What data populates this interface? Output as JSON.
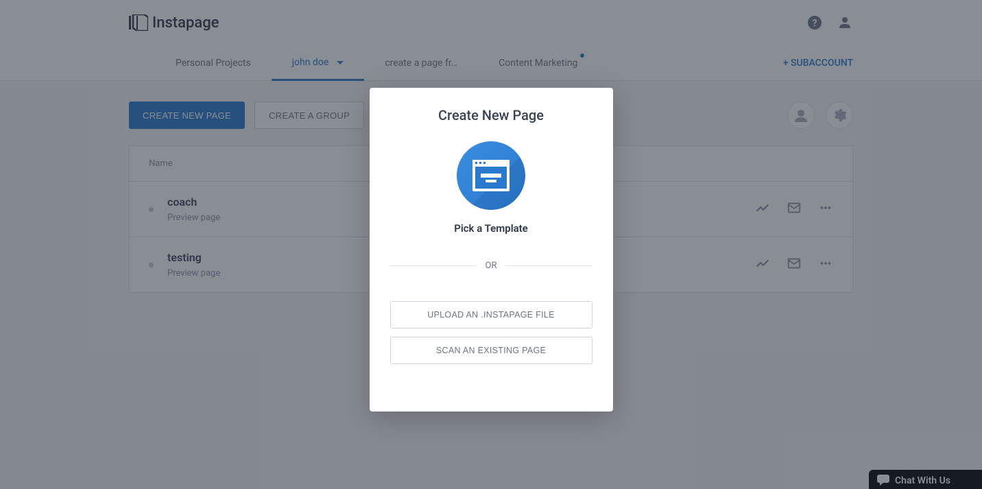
{
  "brand": "Instapage",
  "header": {
    "help_icon": "help",
    "user_icon": "person"
  },
  "nav": {
    "items": [
      {
        "label": "Personal Projects",
        "active": false,
        "dropdown": false,
        "dot": false
      },
      {
        "label": "john doe",
        "active": true,
        "dropdown": true,
        "dot": false
      },
      {
        "label": "create a page fr…",
        "active": false,
        "dropdown": false,
        "dot": false
      },
      {
        "label": "Content Marketing",
        "active": false,
        "dropdown": false,
        "dot": true
      }
    ],
    "subaccount": "+ SUBACCOUNT"
  },
  "actions": {
    "create_page": "CREATE NEW PAGE",
    "create_group": "CREATE A GROUP"
  },
  "table": {
    "header_name": "Name",
    "rows": [
      {
        "title": "coach",
        "subtitle": "Preview page"
      },
      {
        "title": "testing",
        "subtitle": "Preview page"
      }
    ]
  },
  "modal": {
    "title": "Create New Page",
    "pick_template": "Pick a Template",
    "divider": "OR",
    "upload": "UPLOAD AN .INSTAPAGE FILE",
    "scan": "SCAN AN EXISTING PAGE"
  },
  "chat": {
    "label": "Chat With Us"
  }
}
